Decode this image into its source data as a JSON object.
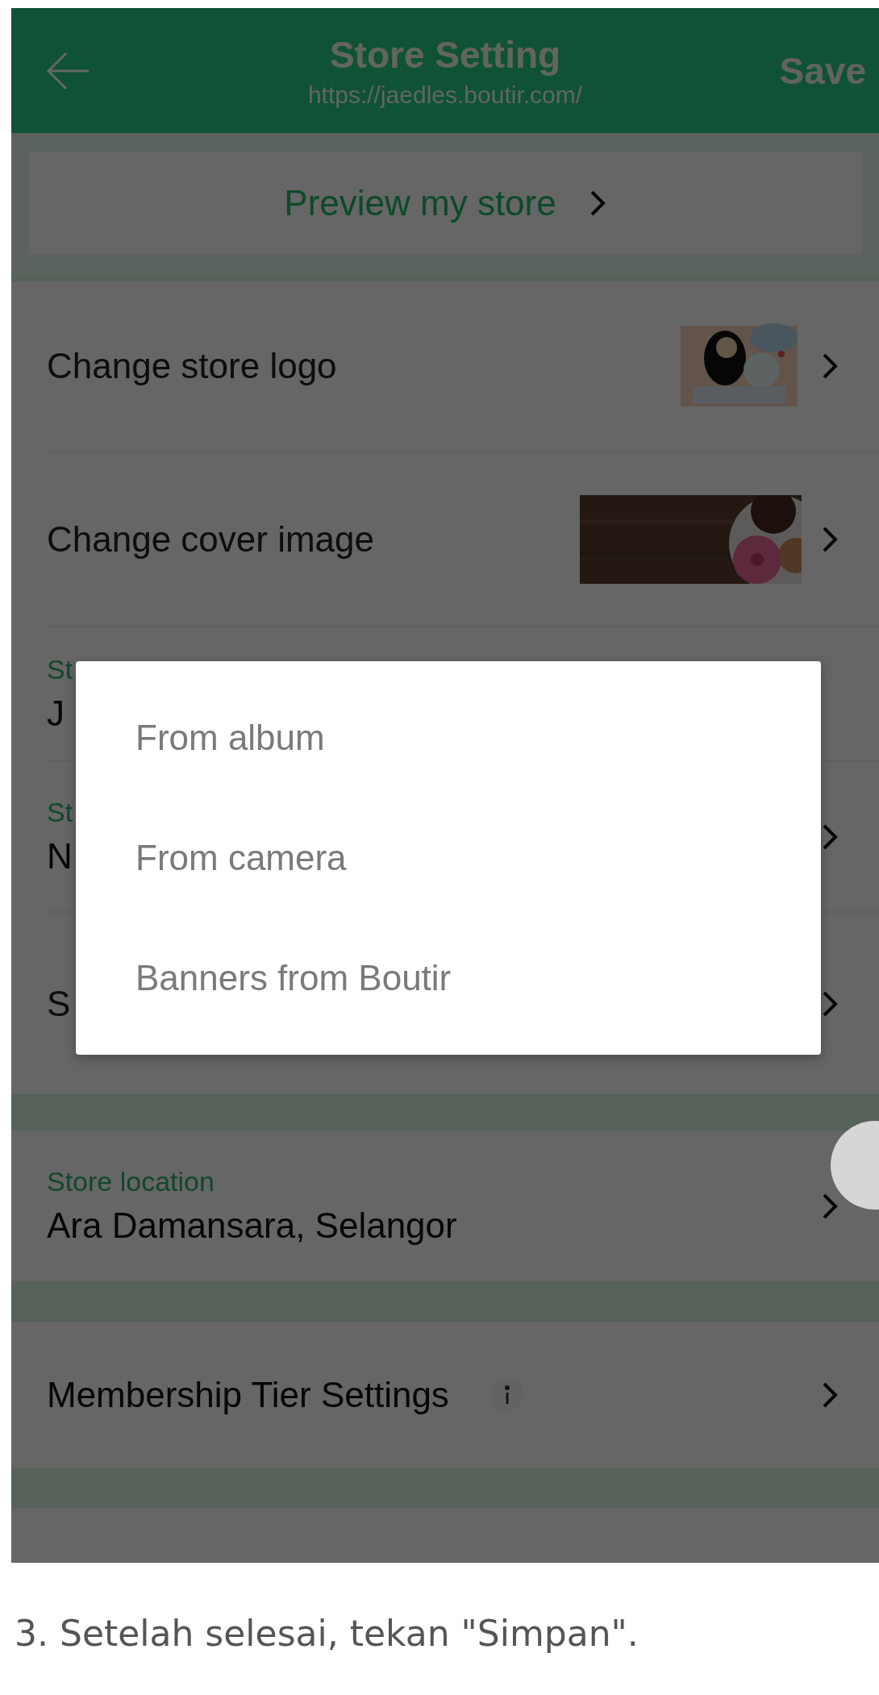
{
  "header": {
    "title": "Store Setting",
    "url": "https://jaedles.boutir.com/",
    "save": "Save"
  },
  "preview": {
    "label": "Preview my store"
  },
  "rows": [
    {
      "label": "Change store logo"
    },
    {
      "label": "Change cover image"
    },
    {
      "kind": "field",
      "label": "St",
      "value": "J",
      "chevron": false
    },
    {
      "kind": "field",
      "label": "St",
      "value": "N",
      "chevron": true
    },
    {
      "kind": "plain",
      "label": "S",
      "chevron": true
    }
  ],
  "location": {
    "label": "Store location",
    "value": "Ara Damansara, Selangor"
  },
  "membership": {
    "label": "Membership Tier Settings"
  },
  "dialog": {
    "options": [
      "From album",
      "From camera",
      "Banners from Boutir"
    ]
  },
  "caption": "3. Setelah selesai, tekan \"Simpan\"."
}
